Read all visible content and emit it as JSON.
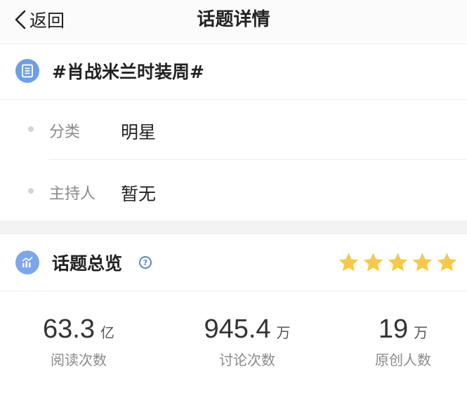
{
  "nav": {
    "back_label": "返回",
    "title": "话题详情"
  },
  "topic": {
    "title": "#肖战米兰时装周#",
    "icon": "document-list-icon"
  },
  "details": [
    {
      "label": "分类",
      "value": "明星"
    },
    {
      "label": "主持人",
      "value": "暂无"
    }
  ],
  "overview": {
    "title": "话题总览",
    "icon": "bar-chart-icon",
    "help_icon": "question-circle-icon",
    "rating_stars": 5,
    "stats": [
      {
        "value": "63.3",
        "unit": "亿",
        "label": "阅读次数"
      },
      {
        "value": "945.4",
        "unit": "万",
        "label": "讨论次数"
      },
      {
        "value": "19",
        "unit": "万",
        "label": "原创人数"
      }
    ]
  },
  "colors": {
    "accent": "#6d9ee8",
    "star": "#f7c948",
    "text": "#222222",
    "secondary_text": "#8a8a8a"
  }
}
